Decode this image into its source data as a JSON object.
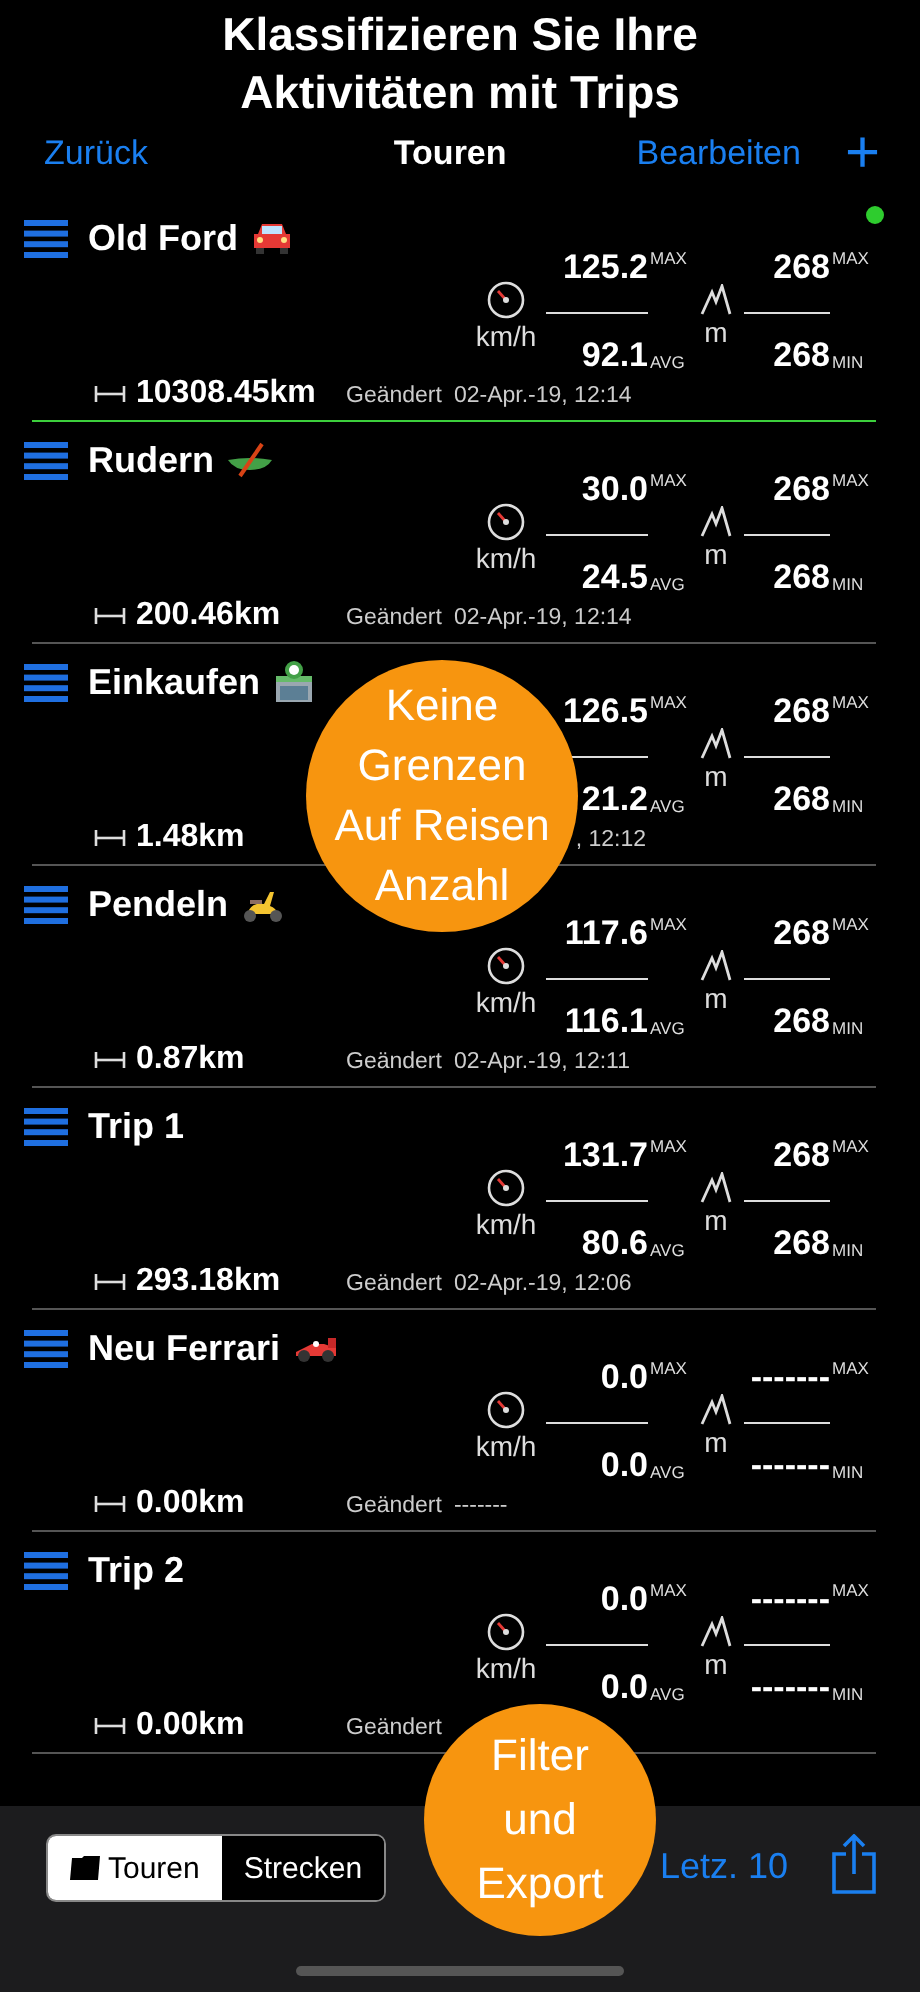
{
  "headline": "Klassifizieren Sie Ihre Aktivitäten mit Trips",
  "nav": {
    "back": "Zurück",
    "title": "Touren",
    "edit": "Bearbeiten",
    "add": "+"
  },
  "trips": [
    {
      "name": "Old Ford",
      "kind": "car",
      "selected": true,
      "speed_unit": "km/h",
      "speed_max": "125.2",
      "speed_max_label": "MAX",
      "speed_avg": "92.1",
      "speed_avg_label": "AVG",
      "alt_unit": "m",
      "alt_max": "268",
      "alt_max_label": "MAX",
      "alt_min": "268",
      "alt_min_label": "MIN",
      "distance": "10308.45km",
      "changed_label": "Geändert",
      "changed": "02-Apr.-19, 12:14"
    },
    {
      "name": "Rudern",
      "kind": "canoe",
      "selected": false,
      "speed_unit": "km/h",
      "speed_max": "30.0",
      "speed_max_label": "MAX",
      "speed_avg": "24.5",
      "speed_avg_label": "AVG",
      "alt_unit": "m",
      "alt_max": "268",
      "alt_max_label": "MAX",
      "alt_min": "268",
      "alt_min_label": "MIN",
      "distance": "200.46km",
      "changed_label": "Geändert",
      "changed": "02-Apr.-19, 12:14"
    },
    {
      "name": "Einkaufen",
      "kind": "store",
      "selected": false,
      "speed_max": "126.5",
      "speed_max_label": "MAX",
      "speed_avg": "21.2",
      "speed_avg_label": "AVG",
      "alt_unit": "m",
      "alt_max": "268",
      "alt_max_label": "MAX",
      "alt_min": "268",
      "alt_min_label": "MIN",
      "distance": "1.48km",
      "changed": ", 12:12"
    },
    {
      "name": "Pendeln",
      "kind": "scooter",
      "selected": false,
      "speed_unit": "km/h",
      "speed_max": "117.6",
      "speed_max_label": "MAX",
      "speed_avg": "116.1",
      "speed_avg_label": "AVG",
      "alt_unit": "m",
      "alt_max": "268",
      "alt_max_label": "MAX",
      "alt_min": "268",
      "alt_min_label": "MIN",
      "distance": "0.87km",
      "changed_label": "Geändert",
      "changed": "02-Apr.-19, 12:11"
    },
    {
      "name": "Trip 1",
      "selected": false,
      "speed_unit": "km/h",
      "speed_max": "131.7",
      "speed_max_label": "MAX",
      "speed_avg": "80.6",
      "speed_avg_label": "AVG",
      "alt_unit": "m",
      "alt_max": "268",
      "alt_max_label": "MAX",
      "alt_min": "268",
      "alt_min_label": "MIN",
      "distance": "293.18km",
      "changed_label": "Geändert",
      "changed": "02-Apr.-19, 12:06"
    },
    {
      "name": "Neu Ferrari",
      "kind": "racecar",
      "selected": false,
      "speed_unit": "km/h",
      "speed_max": "0.0",
      "speed_max_label": "MAX",
      "speed_avg": "0.0",
      "speed_avg_label": "AVG",
      "alt_unit": "m",
      "alt_max": "-------",
      "alt_max_label": "MAX",
      "alt_min": "-------",
      "alt_min_label": "MIN",
      "distance": "0.00km",
      "changed_label": "Geändert",
      "changed": "-------"
    },
    {
      "name": "Trip 2",
      "selected": false,
      "speed_unit": "km/h",
      "speed_max": "0.0",
      "speed_max_label": "MAX",
      "speed_avg": "0.0",
      "speed_avg_label": "AVG",
      "alt_unit": "m",
      "alt_max": "-------",
      "alt_max_label": "MAX",
      "alt_min": "-------",
      "alt_min_label": "MIN",
      "distance": "0.00km",
      "changed_label": "Geändert"
    }
  ],
  "callouts": [
    {
      "lines": [
        "Keine",
        "Grenzen",
        "Auf Reisen",
        "Anzahl"
      ]
    },
    {
      "lines": [
        "Filter",
        "und",
        "Export"
      ]
    }
  ],
  "toolbar": {
    "segments": [
      {
        "label": "Touren",
        "selected": true
      },
      {
        "label": "Strecken",
        "selected": false
      }
    ],
    "recent": "Letz. 10"
  }
}
